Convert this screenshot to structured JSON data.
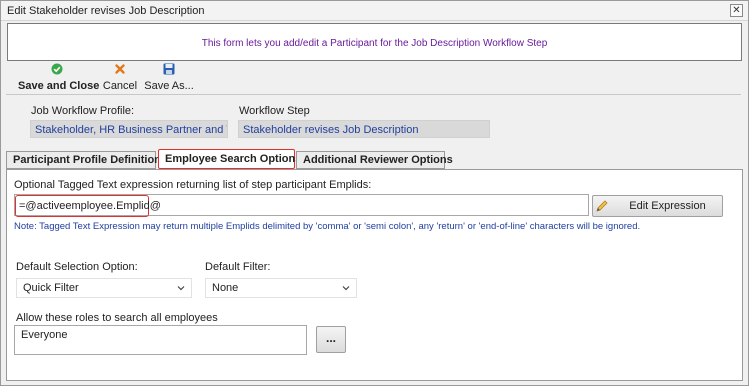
{
  "window": {
    "title": "Edit Stakeholder revises Job Description",
    "close_glyph": "✕"
  },
  "info": {
    "message": "This form lets you add/edit a Participant for the Job Description Workflow Step"
  },
  "toolbar": {
    "save_close_label": "Save and Close",
    "cancel_label": "Cancel",
    "save_as_label": "Save As..."
  },
  "profile": {
    "label": "Job Workflow Profile:",
    "value": "Stakeholder, HR Business Partner and You"
  },
  "step": {
    "label": "Workflow Step",
    "value": "Stakeholder revises Job Description"
  },
  "tabs": [
    {
      "label": "Participant Profile Definition"
    },
    {
      "label": "Employee Search Options"
    },
    {
      "label": "Additional Reviewer Options"
    }
  ],
  "expression": {
    "label": "Optional Tagged Text expression returning list of step participant Emplids:",
    "value": "=@activeemployee.Emplid@",
    "edit_button": "Edit Expression",
    "note": "Note: Tagged Text Expression may return multiple Emplids delimited by 'comma' or 'semi colon', any 'return' or 'end-of-line' characters will be ignored."
  },
  "selection": {
    "label": "Default Selection Option:",
    "value": "Quick Filter"
  },
  "filter": {
    "label": "Default Filter:",
    "value": "None"
  },
  "roles": {
    "label": "Allow these roles to search all employees",
    "value": "Everyone",
    "browse_button": "..."
  },
  "colors": {
    "accent_red": "#e03030",
    "link_blue": "#1f3fa0",
    "info_purple": "#6a1b9a"
  }
}
